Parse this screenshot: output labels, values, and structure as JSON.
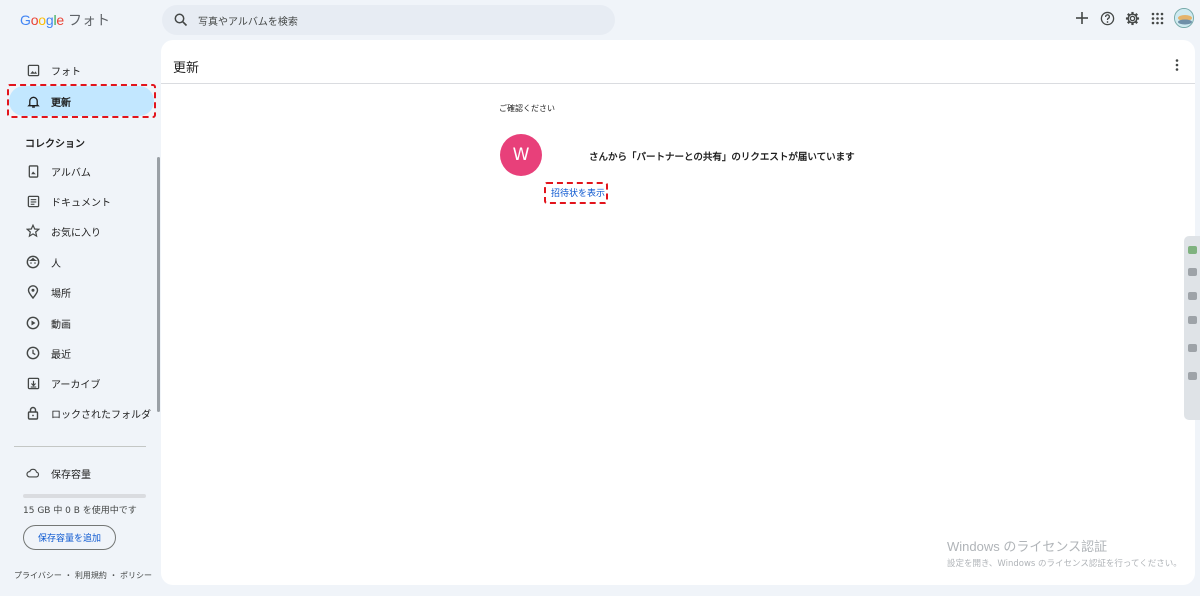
{
  "app": {
    "logo_text": "Google",
    "product_name": "フォト"
  },
  "search": {
    "placeholder": "写真やアルバムを検索"
  },
  "topbar_icons": [
    "plus-icon",
    "help-icon",
    "settings-icon",
    "apps-grid-icon",
    "account-avatar"
  ],
  "sidebar": {
    "items": [
      {
        "label": "フォト",
        "icon": "photo-icon"
      },
      {
        "label": "更新",
        "icon": "bell-icon",
        "active": true
      }
    ],
    "collections_title": "コレクション",
    "collections": [
      {
        "label": "アルバム",
        "icon": "album-icon"
      },
      {
        "label": "ドキュメント",
        "icon": "document-icon"
      },
      {
        "label": "お気に入り",
        "icon": "star-icon"
      },
      {
        "label": "人",
        "icon": "face-icon"
      },
      {
        "label": "場所",
        "icon": "place-icon"
      },
      {
        "label": "動画",
        "icon": "video-icon"
      },
      {
        "label": "最近",
        "icon": "clock-icon"
      },
      {
        "label": "アーカイブ",
        "icon": "archive-icon"
      },
      {
        "label": "ロックされたフォルダ",
        "icon": "lock-icon"
      }
    ],
    "storage": {
      "label": "保存容量",
      "usage_text": "15 GB 中 0 B を使用中です",
      "used_fraction": 0.0,
      "add_button": "保存容量を追加"
    },
    "footer": "プライバシー ・ 利用規約 ・ ポリシー"
  },
  "main": {
    "title": "更新",
    "notice_label": "ご確認ください",
    "notification": {
      "avatar_letter": "W",
      "avatar_color": "#e8407a",
      "text": "さんから「パートナーとの共有」のリクエストが届いています",
      "link": "招待状を表示"
    }
  },
  "watermark": {
    "title": "Windows のライセンス認証",
    "subtitle": "設定を開き、Windows のライセンス認証を行ってください。"
  },
  "colors": {
    "accent": "#0b57d0",
    "active_nav": "#c2e7ff",
    "highlight_dash": "#e2141c",
    "background": "#f0f4f9"
  }
}
